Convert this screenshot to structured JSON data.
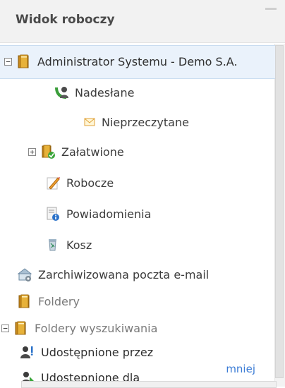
{
  "panel": {
    "title": "Widok roboczy",
    "collapse_icon": "minus-icon"
  },
  "tree": [
    {
      "label": "Administrator Systemu - Demo S.A.",
      "icon": "folder-icon",
      "toggle": "collapse",
      "selected": true
    },
    {
      "label": "Nadesłane",
      "icon": "inbox-user-icon"
    },
    {
      "label": "Nieprzeczytane",
      "icon": "envelope-icon"
    },
    {
      "label": "Załatwione",
      "icon": "folder-check-icon",
      "toggle": "expand"
    },
    {
      "label": "Robocze",
      "icon": "draft-pencil-icon"
    },
    {
      "label": "Powiadomienia",
      "icon": "notification-icon"
    },
    {
      "label": "Kosz",
      "icon": "trash-icon"
    },
    {
      "label": "Zarchiwizowana poczta e-mail",
      "icon": "archive-mail-icon"
    },
    {
      "label": "Foldery",
      "icon": "folder-icon"
    },
    {
      "label": "Foldery wyszukiwania",
      "icon": "folder-icon",
      "toggle": "collapse"
    },
    {
      "label": "Udostępnione przez",
      "icon": "shared-by-icon"
    },
    {
      "label": "Udostępnione dla",
      "icon": "shared-for-icon"
    }
  ],
  "footer": {
    "less_link": "mniej"
  }
}
